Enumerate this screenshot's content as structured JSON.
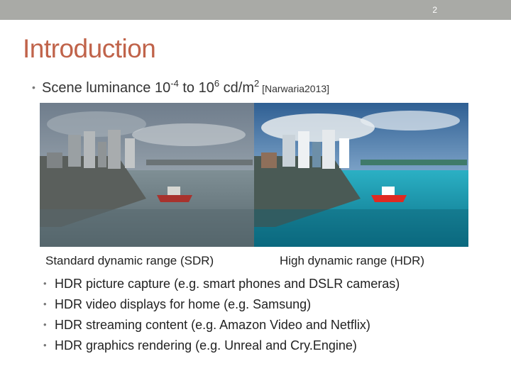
{
  "slide_number": "2",
  "title": "Introduction",
  "main_bullet": {
    "prefix": "Scene luminance 10",
    "exp1": "-4",
    "mid": " to 10",
    "exp2": "6",
    "unit": " cd/m",
    "exp3": "2",
    "citation": " [Narwaria2013]"
  },
  "captions": {
    "sdr": "Standard dynamic range (SDR)",
    "hdr": "High dynamic range (HDR)"
  },
  "bullets": [
    "HDR picture capture (e.g. smart phones and DSLR cameras)",
    "HDR video displays for home (e.g. Samsung)",
    "HDR streaming content (e.g. Amazon Video and Netflix)",
    "HDR graphics rendering (e.g. Unreal and Cry.Engine)"
  ],
  "colors": {
    "title": "#c0634a",
    "topbar": "#a9aaa6"
  }
}
